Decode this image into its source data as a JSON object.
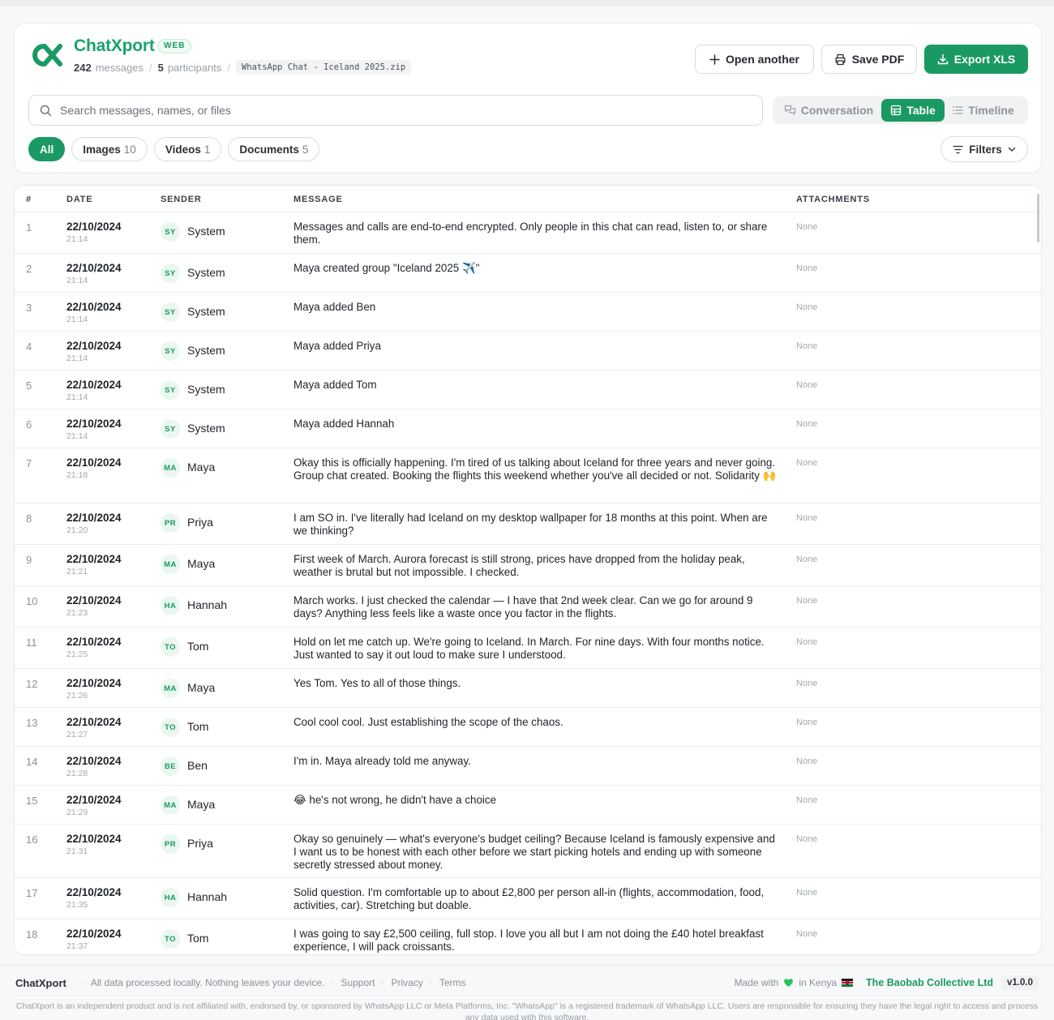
{
  "brand": {
    "name": "ChatXport",
    "badge": "WEB",
    "messages_count": "242",
    "messages_label": "messages",
    "participants_count": "5",
    "participants_label": "participants",
    "file_name": "WhatsApp Chat - Iceland 2025.zip",
    "accent_color": "#1a9a62"
  },
  "actions": {
    "open_another": "Open another",
    "save_pdf": "Save PDF",
    "export_xls": "Export XLS"
  },
  "search": {
    "placeholder": "Search messages, names, or files"
  },
  "views": {
    "conversation": "Conversation",
    "table": "Table",
    "timeline": "Timeline",
    "selected": "Table"
  },
  "filters": {
    "chips": [
      {
        "label": "All",
        "count": ""
      },
      {
        "label": "Images",
        "count": "10"
      },
      {
        "label": "Videos",
        "count": "1"
      },
      {
        "label": "Documents",
        "count": "5"
      }
    ],
    "selected": "All",
    "filters_button": "Filters"
  },
  "table": {
    "headers": {
      "num": "#",
      "date": "DATE",
      "sender": "SENDER",
      "message": "MESSAGE",
      "attachments": "ATTACHMENTS"
    },
    "rows": [
      {
        "num": "1",
        "date": "22/10/2024",
        "time": "21:14",
        "initials": "SY",
        "sender": "System",
        "message": "Messages and calls are end-to-end encrypted. Only people in this chat can read, listen to, or share them.",
        "attachments": "None"
      },
      {
        "num": "2",
        "date": "22/10/2024",
        "time": "21:14",
        "initials": "SY",
        "sender": "System",
        "message": "Maya created group \"Iceland 2025 ✈️\"",
        "attachments": "None"
      },
      {
        "num": "3",
        "date": "22/10/2024",
        "time": "21:14",
        "initials": "SY",
        "sender": "System",
        "message": "Maya added Ben",
        "attachments": "None"
      },
      {
        "num": "4",
        "date": "22/10/2024",
        "time": "21:14",
        "initials": "SY",
        "sender": "System",
        "message": "Maya added Priya",
        "attachments": "None"
      },
      {
        "num": "5",
        "date": "22/10/2024",
        "time": "21:14",
        "initials": "SY",
        "sender": "System",
        "message": "Maya added Tom",
        "attachments": "None"
      },
      {
        "num": "6",
        "date": "22/10/2024",
        "time": "21:14",
        "initials": "SY",
        "sender": "System",
        "message": "Maya added Hannah",
        "attachments": "None"
      },
      {
        "num": "7",
        "date": "22/10/2024",
        "time": "21:18",
        "initials": "MA",
        "sender": "Maya",
        "message": "Okay this is officially happening. I'm tired of us talking about Iceland for three years and never going. Group chat created. Booking the flights this weekend whether you've all decided or not. Solidarity 🙌",
        "attachments": "None"
      },
      {
        "num": "8",
        "date": "22/10/2024",
        "time": "21:20",
        "initials": "PR",
        "sender": "Priya",
        "message": "I am SO in. I've literally had Iceland on my desktop wallpaper for 18 months at this point. When are we thinking?",
        "attachments": "None"
      },
      {
        "num": "9",
        "date": "22/10/2024",
        "time": "21:21",
        "initials": "MA",
        "sender": "Maya",
        "message": "First week of March. Aurora forecast is still strong, prices have dropped from the holiday peak, weather is brutal but not impossible. I checked.",
        "attachments": "None"
      },
      {
        "num": "10",
        "date": "22/10/2024",
        "time": "21:23",
        "initials": "HA",
        "sender": "Hannah",
        "message": "March works. I just checked the calendar — I have that 2nd week clear. Can we go for around 9 days? Anything less feels like a waste once you factor in the flights.",
        "attachments": "None"
      },
      {
        "num": "11",
        "date": "22/10/2024",
        "time": "21:25",
        "initials": "TO",
        "sender": "Tom",
        "message": "Hold on let me catch up. We're going to Iceland. In March. For nine days. With four months notice. Just wanted to say it out loud to make sure I understood.",
        "attachments": "None"
      },
      {
        "num": "12",
        "date": "22/10/2024",
        "time": "21:26",
        "initials": "MA",
        "sender": "Maya",
        "message": "Yes Tom. Yes to all of those things.",
        "attachments": "None"
      },
      {
        "num": "13",
        "date": "22/10/2024",
        "time": "21:27",
        "initials": "TO",
        "sender": "Tom",
        "message": "Cool cool cool. Just establishing the scope of the chaos.",
        "attachments": "None"
      },
      {
        "num": "14",
        "date": "22/10/2024",
        "time": "21:28",
        "initials": "BE",
        "sender": "Ben",
        "message": "I'm in. Maya already told me anyway.",
        "attachments": "None"
      },
      {
        "num": "15",
        "date": "22/10/2024",
        "time": "21:29",
        "initials": "MA",
        "sender": "Maya",
        "message": "😂 he's not wrong, he didn't have a choice",
        "attachments": "None"
      },
      {
        "num": "16",
        "date": "22/10/2024",
        "time": "21:31",
        "initials": "PR",
        "sender": "Priya",
        "message": "Okay so genuinely — what's everyone's budget ceiling? Because Iceland is famously expensive and I want us to be honest with each other before we start picking hotels and ending up with someone secretly stressed about money.",
        "attachments": "None"
      },
      {
        "num": "17",
        "date": "22/10/2024",
        "time": "21:35",
        "initials": "HA",
        "sender": "Hannah",
        "message": "Solid question. I'm comfortable up to about £2,800 per person all-in (flights, accommodation, food, activities, car). Stretching but doable.",
        "attachments": "None"
      },
      {
        "num": "18",
        "date": "22/10/2024",
        "time": "21:37",
        "initials": "TO",
        "sender": "Tom",
        "message": "I was going to say £2,500 ceiling, full stop. I love you all but I am not doing the £40 hotel breakfast experience, I will pack croissants.",
        "attachments": "None"
      }
    ]
  },
  "footer": {
    "brand": "ChatXport",
    "tagline": "All data processed locally. Nothing leaves your device.",
    "support": "Support",
    "privacy": "Privacy",
    "terms": "Terms",
    "made_with": "Made with",
    "in_kenya": "in Kenya",
    "company": "The Baobab Collective Ltd",
    "version": "v1.0.0",
    "disclaimer": "ChatXport is an independent product and is not affiliated with, endorsed by, or sponsored by WhatsApp LLC or Meta Platforms, Inc. \"WhatsApp\" is a registered trademark of WhatsApp LLC. Users are responsible for ensuring they have the legal right to access and process any data used with this software."
  }
}
